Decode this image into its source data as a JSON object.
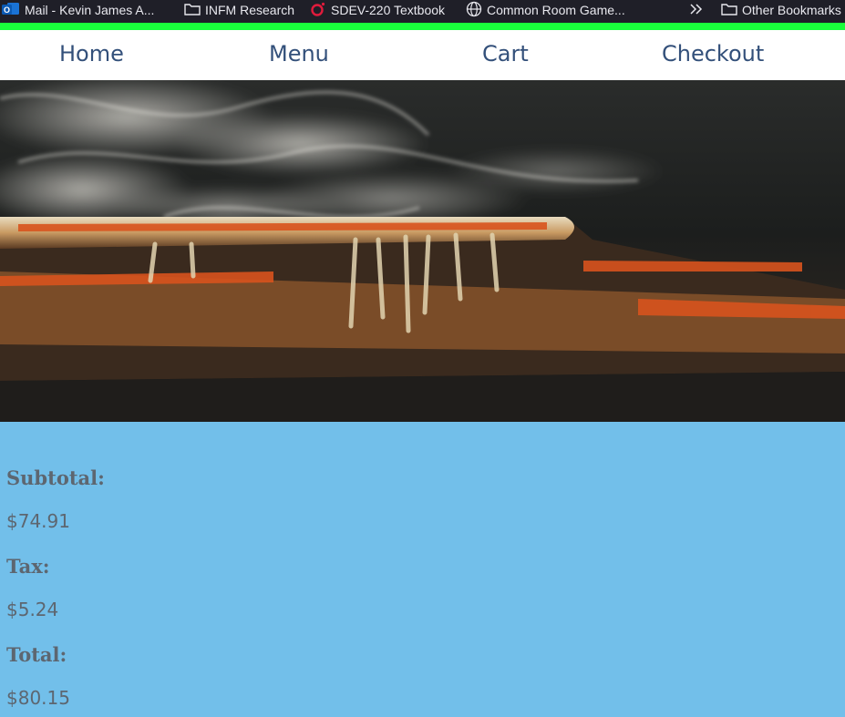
{
  "bookmarks": {
    "items": [
      {
        "label": "Mail - Kevin James A...",
        "icon": "outlook-icon"
      },
      {
        "label": "INFM Research",
        "icon": "folder-icon"
      },
      {
        "label": "SDEV-220 Textbook",
        "icon": "red-ring-icon"
      },
      {
        "label": "Common Room Game...",
        "icon": "globe-icon"
      },
      {
        "label": "Other Bookmarks",
        "icon": "folder-icon"
      }
    ],
    "overflow_icon": "double-chevron-right-icon"
  },
  "nav": {
    "items": [
      {
        "label": "Home"
      },
      {
        "label": "Menu"
      },
      {
        "label": "Cart"
      },
      {
        "label": "Checkout"
      }
    ]
  },
  "hero": {
    "image": "steaming-pizza-photo"
  },
  "totals": {
    "subtotal_label": "Subtotal:",
    "subtotal_value": "$74.91",
    "tax_label": "Tax:",
    "tax_value": "$5.24",
    "total_label": "Total:",
    "total_value": "$80.15"
  },
  "colors": {
    "bookmarks_bg": "#1f1f28",
    "accent_green": "#19ff3c",
    "nav_text": "#33507a",
    "page_bg": "#72bfea",
    "totals_text": "#5d6670"
  }
}
